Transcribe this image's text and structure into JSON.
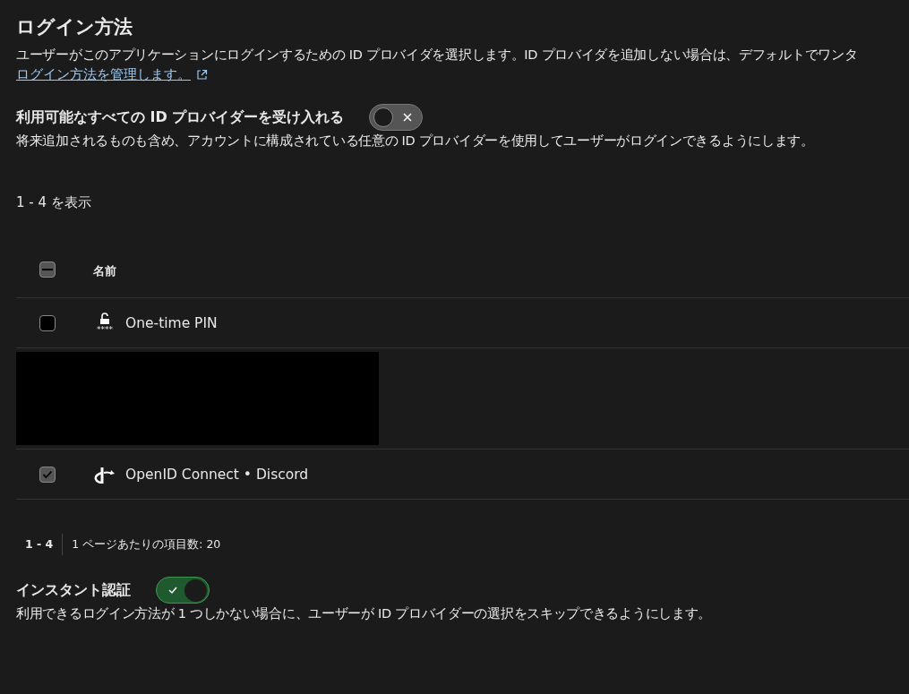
{
  "title": "ログイン方法",
  "description": "ユーザーがこのアプリケーションにログインするための ID プロバイダを選択します。ID プロバイダを追加しない場合は、デフォルトでワンタ",
  "manage_link": "ログイン方法を管理します。",
  "accept_all": {
    "label": "利用可能なすべての ID プロバイダーを受け入れる",
    "on": false,
    "description": "将来追加されるものも含め、アカウントに構成されている任意の ID プロバイダーを使用してユーザーがログインできるようにします。"
  },
  "showing": "1 - 4 を表示",
  "table": {
    "header_checkbox": {
      "mixed": true
    },
    "columns": [
      "名前"
    ],
    "rows": [
      {
        "kind": "pin",
        "name": "One-time PIN",
        "icon_caption": "****",
        "checked": false
      },
      {
        "kind": "redacted"
      },
      {
        "kind": "redacted"
      },
      {
        "kind": "oidc",
        "name": "OpenID Connect • Discord",
        "checked": true
      }
    ]
  },
  "pagination": {
    "range": "1 - 4",
    "per_page": "1 ページあたりの項目数: 20"
  },
  "instant_auth": {
    "label": "インスタント認証",
    "on": true,
    "description": "利用できるログイン方法が 1 つしかない場合に、ユーザーが ID プロバイダーの選択をスキップできるようにします。"
  }
}
